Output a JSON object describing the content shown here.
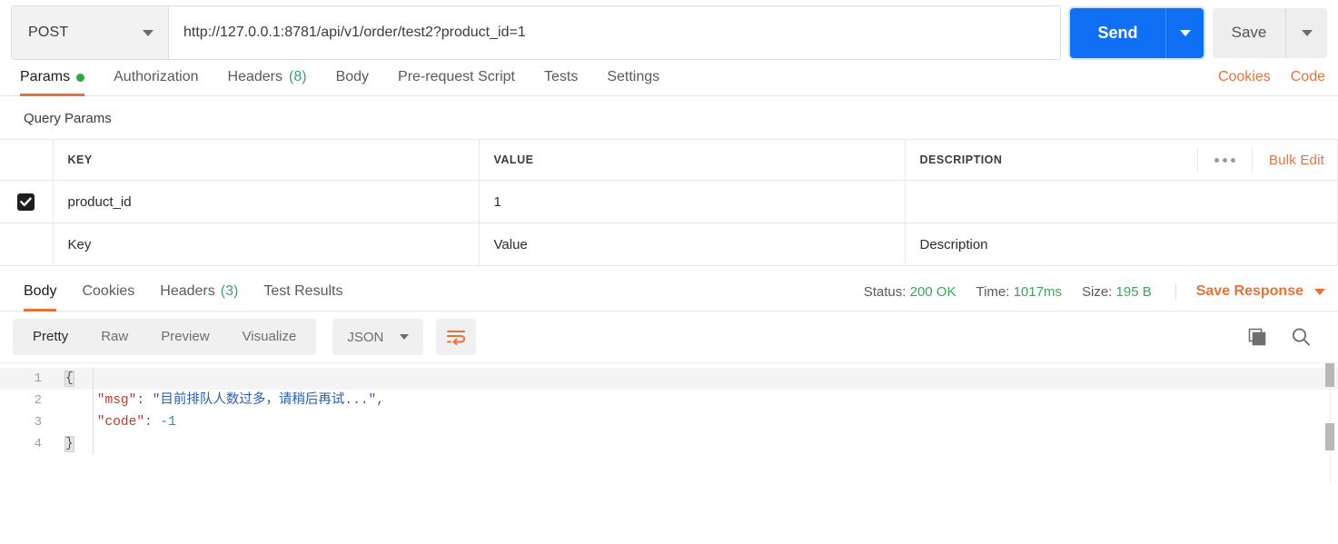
{
  "request": {
    "method": "POST",
    "url": "http://127.0.0.1:8781/api/v1/order/test2?product_id=1",
    "send_label": "Send",
    "save_label": "Save",
    "tabs": [
      {
        "label": "Params",
        "badge": "",
        "dot": true,
        "active": true
      },
      {
        "label": "Authorization",
        "badge": "",
        "dot": false,
        "active": false
      },
      {
        "label": "Headers",
        "badge": "(8)",
        "dot": false,
        "active": false
      },
      {
        "label": "Body",
        "badge": "",
        "dot": false,
        "active": false
      },
      {
        "label": "Pre-request Script",
        "badge": "",
        "dot": false,
        "active": false
      },
      {
        "label": "Tests",
        "badge": "",
        "dot": false,
        "active": false
      },
      {
        "label": "Settings",
        "badge": "",
        "dot": false,
        "active": false
      }
    ],
    "cookies_link": "Cookies",
    "code_link": "Code"
  },
  "query_params": {
    "section_title": "Query Params",
    "columns": [
      "KEY",
      "VALUE",
      "DESCRIPTION"
    ],
    "bulk_edit_label": "Bulk Edit",
    "rows": [
      {
        "checked": true,
        "key": "product_id",
        "value": "1",
        "description": ""
      }
    ],
    "new_row": {
      "key_placeholder": "Key",
      "value_placeholder": "Value",
      "description_placeholder": "Description"
    }
  },
  "response": {
    "tabs": [
      {
        "label": "Body",
        "badge": "",
        "active": true
      },
      {
        "label": "Cookies",
        "badge": "",
        "active": false
      },
      {
        "label": "Headers",
        "badge": "(3)",
        "active": false
      },
      {
        "label": "Test Results",
        "badge": "",
        "active": false
      }
    ],
    "status_label": "Status:",
    "status_value": "200 OK",
    "time_label": "Time:",
    "time_value": "1017ms",
    "size_label": "Size:",
    "size_value": "195 B",
    "save_response_label": "Save Response",
    "view_modes": [
      {
        "label": "Pretty",
        "active": true
      },
      {
        "label": "Raw",
        "active": false
      },
      {
        "label": "Preview",
        "active": false
      },
      {
        "label": "Visualize",
        "active": false
      }
    ],
    "format": "JSON",
    "icons": {
      "wrap": "wrap-lines-icon",
      "copy": "copy-icon",
      "search": "search-icon"
    },
    "body_lines": [
      {
        "num": "1",
        "segments": [
          {
            "t": "{",
            "cls": "brace"
          }
        ]
      },
      {
        "num": "2",
        "segments": [
          {
            "t": "    ",
            "cls": "plain"
          },
          {
            "t": "\"msg\"",
            "cls": "key"
          },
          {
            "t": ": ",
            "cls": "punct"
          },
          {
            "t": "\"目前排队人数过多，请稍后再试...\"",
            "cls": "str"
          },
          {
            "t": ",",
            "cls": "punct"
          }
        ]
      },
      {
        "num": "3",
        "segments": [
          {
            "t": "    ",
            "cls": "plain"
          },
          {
            "t": "\"code\"",
            "cls": "key"
          },
          {
            "t": ": ",
            "cls": "punct"
          },
          {
            "t": "-1",
            "cls": "num"
          }
        ]
      },
      {
        "num": "4",
        "segments": [
          {
            "t": "}",
            "cls": "brace"
          }
        ]
      }
    ]
  },
  "colors": {
    "accent_orange": "#e8713b",
    "send_blue": "#1070f5",
    "status_green": "#3aa55d",
    "json_key": "#c0392b",
    "json_string": "#2a5db0",
    "json_number": "#1a9a8b"
  }
}
